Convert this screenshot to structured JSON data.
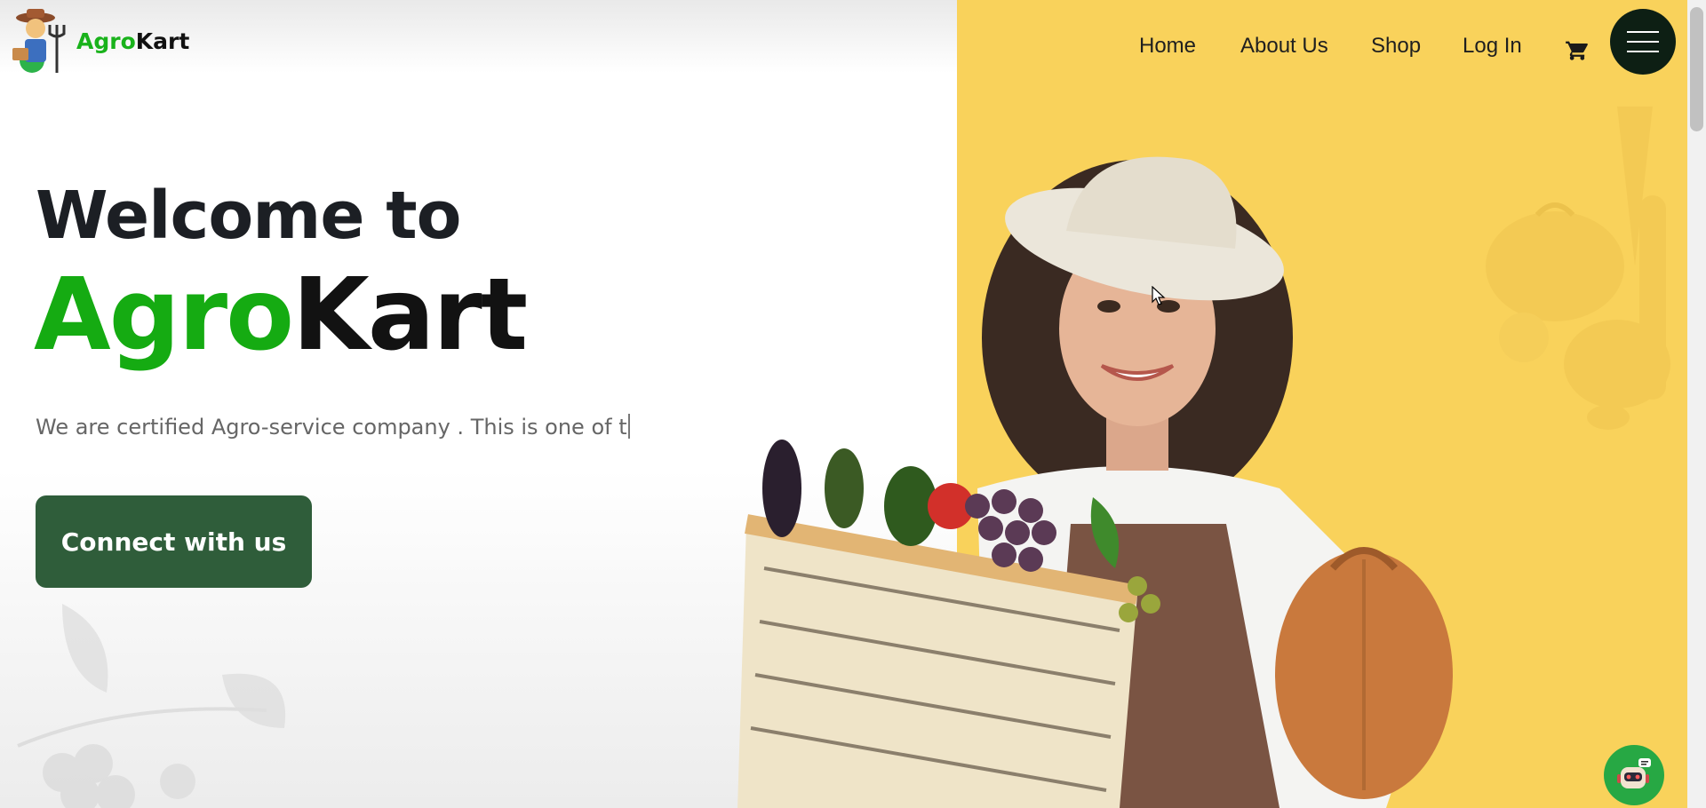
{
  "logo": {
    "part1": "Agro",
    "part2": "Kart",
    "icon": "farmer-logo-icon"
  },
  "nav": {
    "items": [
      "Home",
      "About Us",
      "Shop",
      "Log In"
    ],
    "cart_icon": "cart-icon",
    "menu_icon": "hamburger-menu-icon"
  },
  "hero": {
    "welcome": "Welcome to",
    "brand_part1": "Agro",
    "brand_part2": "Kart",
    "tagline": "We are certified Agro-service company . This is one of t",
    "cta_label": "Connect with us"
  },
  "chatbot": {
    "icon": "robot-chat-icon"
  },
  "colors": {
    "brand_green": "#15ab12",
    "cta_green": "#2f5d3a",
    "hero_yellow": "#f9d25b",
    "dark": "#121212"
  }
}
